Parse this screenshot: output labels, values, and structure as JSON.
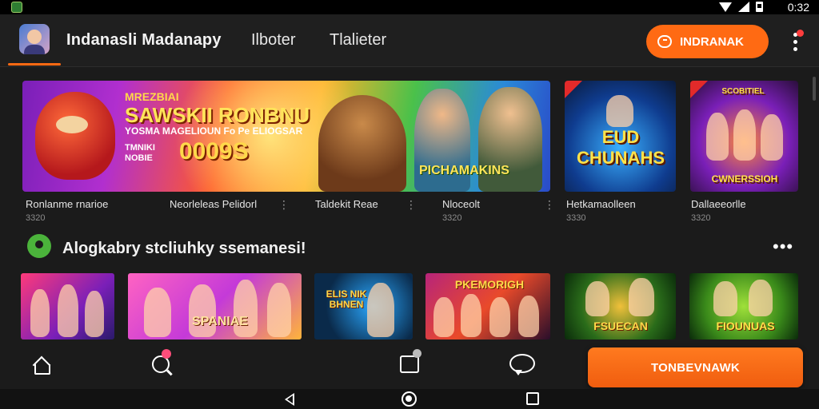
{
  "status_bar": {
    "time": "0:32"
  },
  "app_bar": {
    "title": "Indanasli Madanapy",
    "tabs": [
      "Ilboter",
      "Tlalieter"
    ],
    "cta_label": "INDRANAK"
  },
  "featured": {
    "banner": {
      "line1": "MREZBIAI",
      "line2": "SAWSKII RONBNU",
      "line3": "YOSMA MAGELIOUN Fo Pe ELIOGSAR",
      "line4": "TMNIKI NOBIE",
      "amount": "0009S",
      "tag": "PICHAMAKINS"
    },
    "thumb_a_title": "EUD CHUNAHS",
    "thumb_b_title": "CWNERSSIOH",
    "thumb_b_top": "SCOBITIEL",
    "items": [
      {
        "title": "Ronlanme rnarioe",
        "sub": "3320"
      },
      {
        "title": "Neorleleas Pelidorl",
        "sub": ""
      },
      {
        "title": "Taldekit Reae",
        "sub": ""
      },
      {
        "title": "Nloceolt",
        "sub": "3320"
      },
      {
        "title": "Hetkamaolleen",
        "sub": "3330"
      },
      {
        "title": "Dallaeeorlle",
        "sub": "3320"
      }
    ]
  },
  "section": {
    "title": "Alogkabry stcliuhky ssemanesi!",
    "games": [
      {
        "title": ""
      },
      {
        "title": "SPANIAE"
      },
      {
        "title": "ELIS NIK BHNEN"
      },
      {
        "title": "PKEMORIGH"
      },
      {
        "title": "FSUECAN"
      },
      {
        "title": "FIOUNUAS"
      }
    ]
  },
  "bottom_nav": {
    "cta_label": "TONBEVNAWK"
  },
  "colors": {
    "accent": "#ff6a13",
    "background": "#1b1b1b",
    "section_icon": "#4bb33b"
  }
}
